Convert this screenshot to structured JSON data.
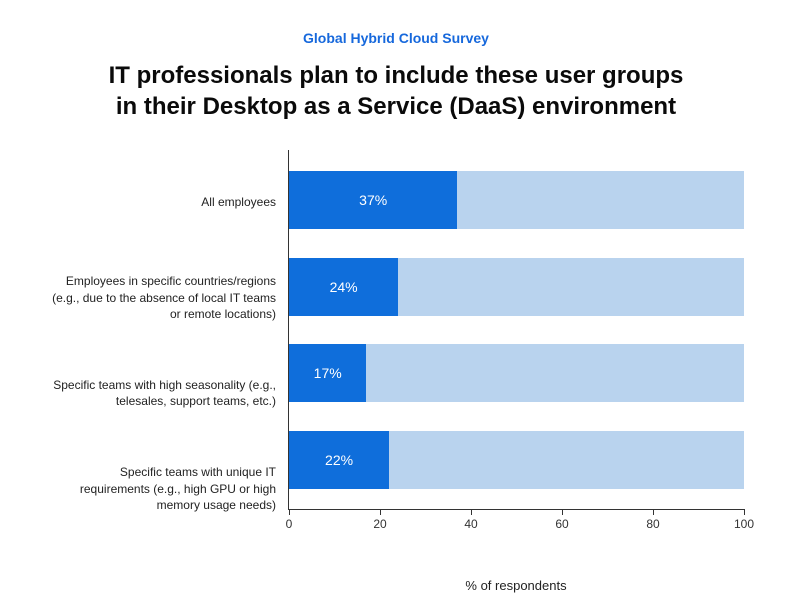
{
  "header": {
    "subtitle": "Global Hybrid Cloud Survey",
    "title_line1": "IT professionals plan to include these user groups",
    "title_line2": "in their Desktop as a Service (DaaS) environment"
  },
  "chart_data": {
    "type": "bar",
    "orientation": "horizontal",
    "categories": [
      "All employees",
      "Employees in specific countries/regions (e.g., due to the absence of local IT teams or remote locations)",
      "Specific teams with high seasonality (e.g., telesales, support teams, etc.)",
      "Specific teams with unique IT requirements (e.g., high GPU or high memory usage needs)"
    ],
    "values": [
      37,
      24,
      17,
      22
    ],
    "value_labels": [
      "37%",
      "24%",
      "17%",
      "22%"
    ],
    "xlabel": "% of respondents",
    "xlim": [
      0,
      100
    ],
    "x_ticks": [
      0,
      20,
      40,
      60,
      80,
      100
    ],
    "colors": {
      "fill": "#0f6edb",
      "track": "#b9d3ee"
    }
  }
}
